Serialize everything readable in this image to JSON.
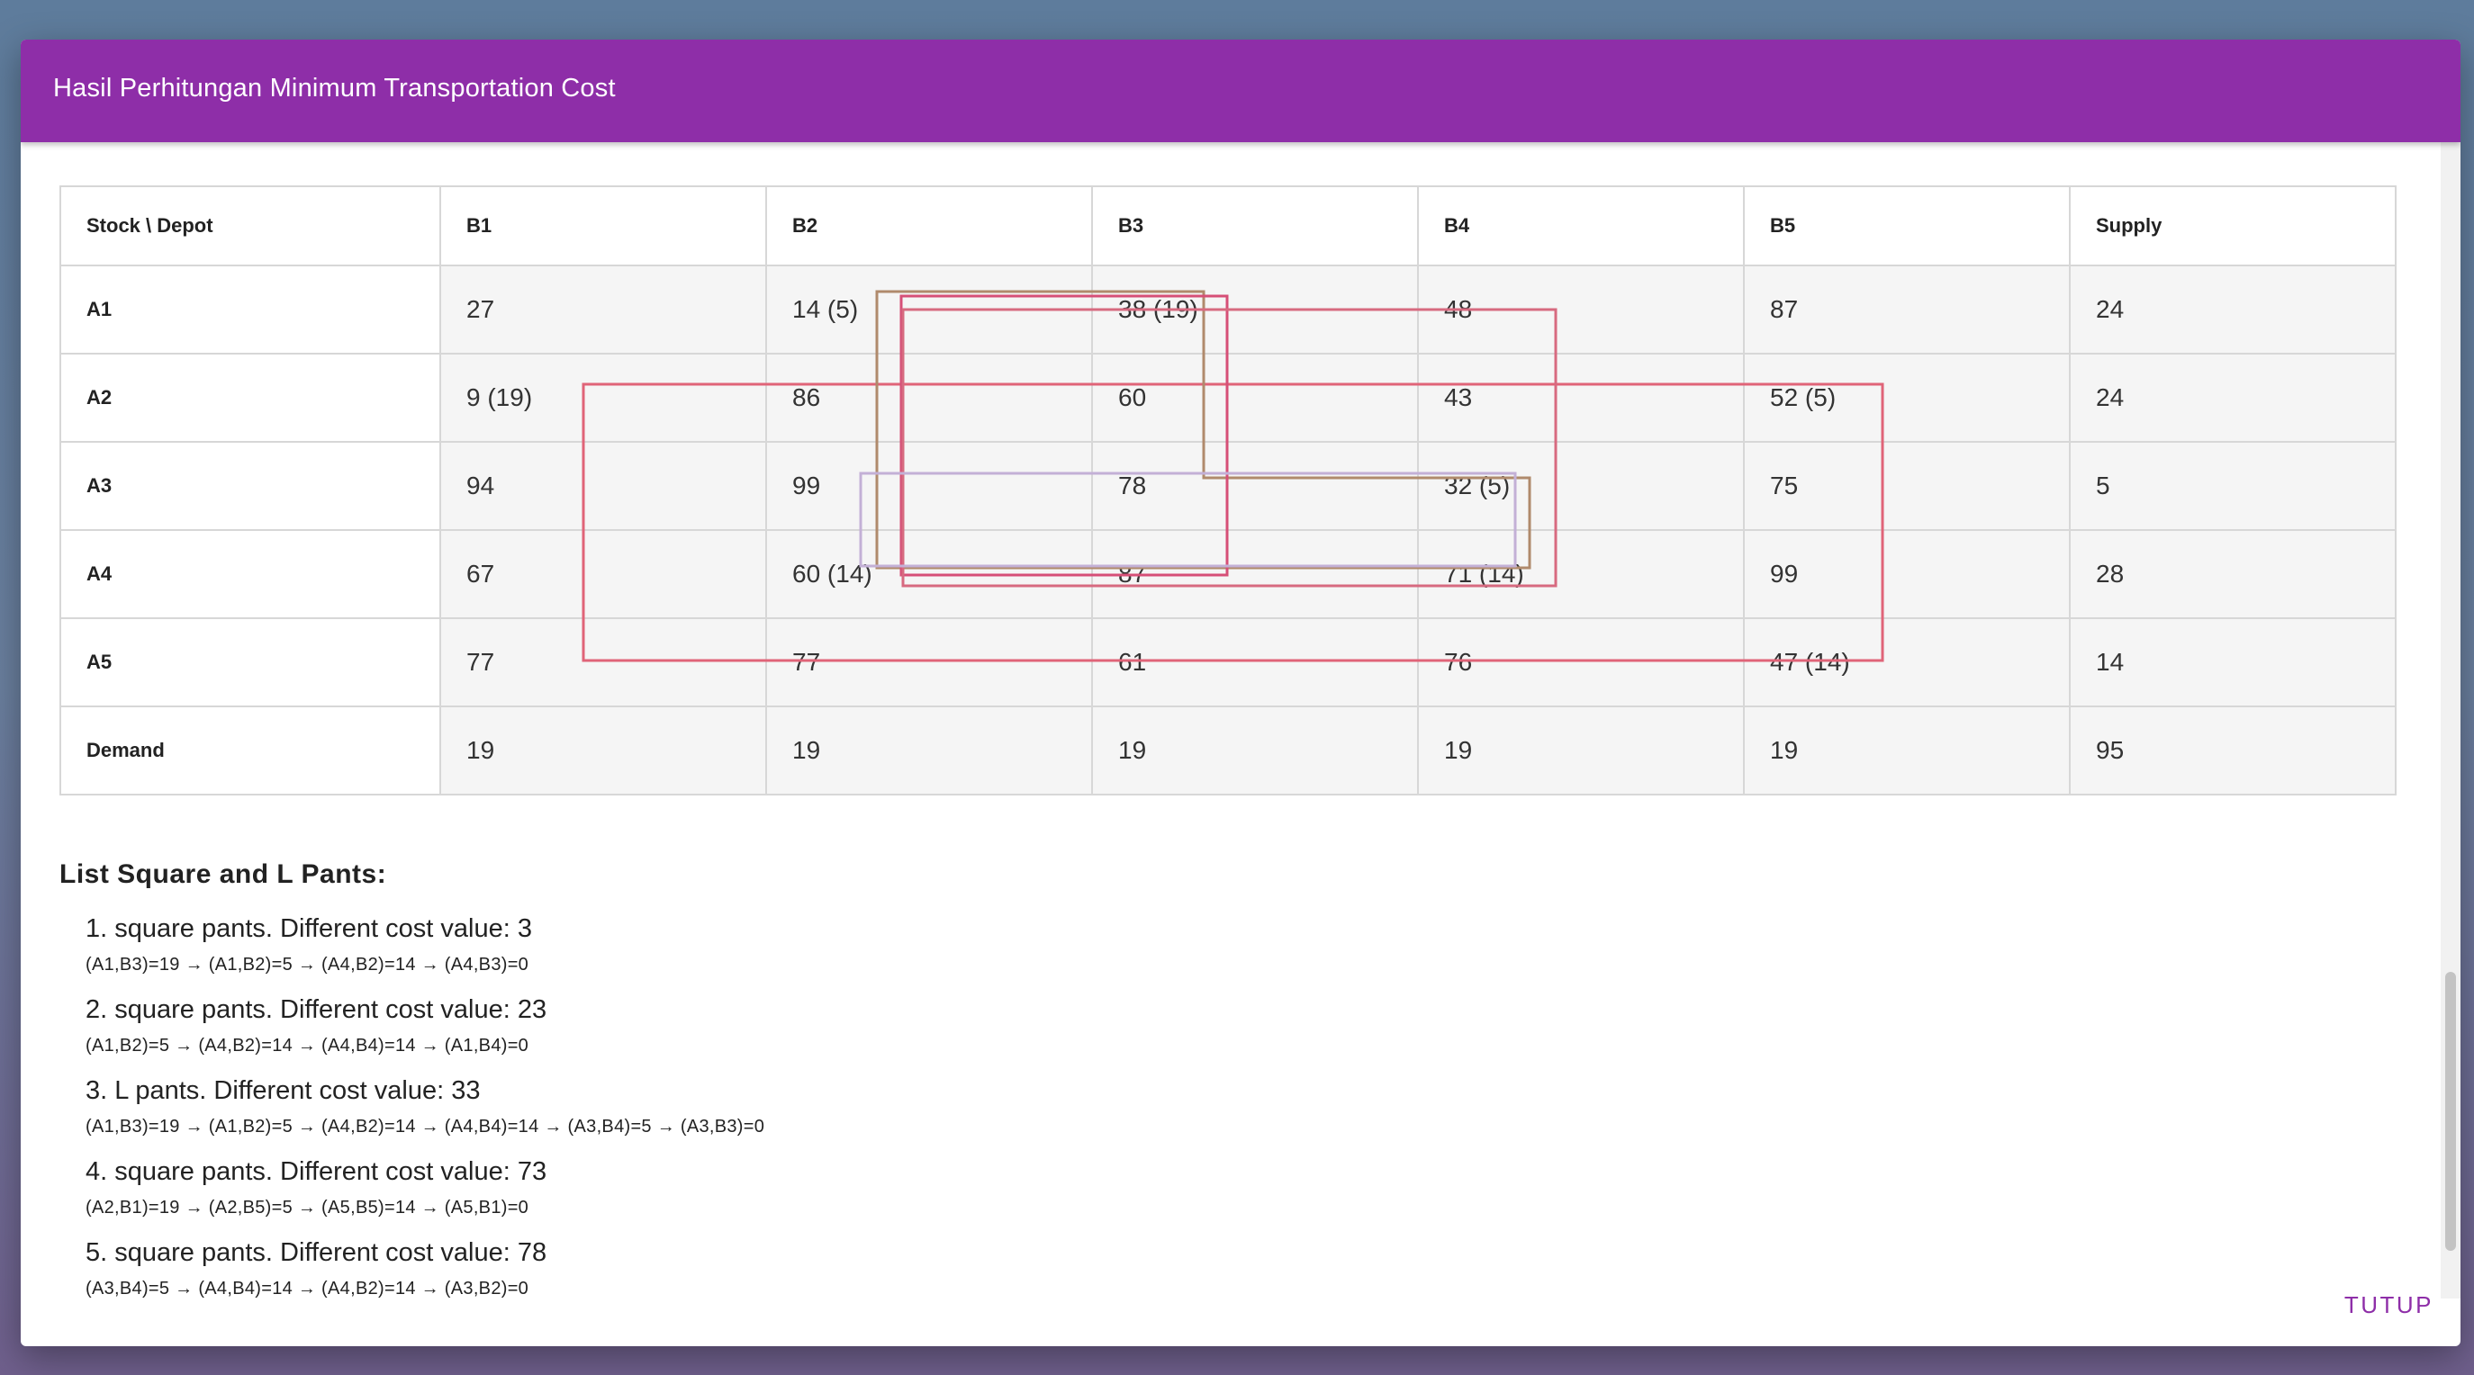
{
  "dialog": {
    "title": "Hasil Perhitungan Minimum Transportation Cost",
    "close_label": "TUTUP",
    "accent_color": "#8e2ea8"
  },
  "table": {
    "headers": [
      "Stock \\ Depot",
      "B1",
      "B2",
      "B3",
      "B4",
      "B5",
      "Supply"
    ],
    "rows": [
      {
        "label": "A1",
        "cells": [
          "27",
          "14 (5)",
          "38 (19)",
          "48",
          "87",
          "24"
        ]
      },
      {
        "label": "A2",
        "cells": [
          "9 (19)",
          "86",
          "60",
          "43",
          "52 (5)",
          "24"
        ]
      },
      {
        "label": "A3",
        "cells": [
          "94",
          "99",
          "78",
          "32 (5)",
          "75",
          "5"
        ]
      },
      {
        "label": "A4",
        "cells": [
          "67",
          "60 (14)",
          "87",
          "71 (14)",
          "99",
          "28"
        ]
      },
      {
        "label": "A5",
        "cells": [
          "77",
          "77",
          "61",
          "76",
          "47 (14)",
          "14"
        ]
      },
      {
        "label": "Demand",
        "cells": [
          "19",
          "19",
          "19",
          "19",
          "19",
          "95"
        ]
      }
    ]
  },
  "loop_colors": {
    "loop1": "#e06478",
    "loop2": "#b08a6c",
    "loop3": "#d64f77",
    "loop4": "#d76a80",
    "loop5": "#c3b0d6"
  },
  "list": {
    "title": "List Square and L Pants:",
    "items": [
      {
        "text": "1. square pants. Different cost value: 3",
        "path": "(A1,B3)=19 → (A1,B2)=5 → (A4,B2)=14 → (A4,B3)=0"
      },
      {
        "text": "2. square pants. Different cost value: 23",
        "path": "(A1,B2)=5 → (A4,B2)=14 → (A4,B4)=14 → (A1,B4)=0"
      },
      {
        "text": "3. L pants. Different cost value: 33",
        "path": "(A1,B3)=19 → (A1,B2)=5 → (A4,B2)=14 → (A4,B4)=14 → (A3,B4)=5 → (A3,B3)=0"
      },
      {
        "text": "4. square pants. Different cost value: 73",
        "path": "(A2,B1)=19 → (A2,B5)=5 → (A5,B5)=14 → (A5,B1)=0"
      },
      {
        "text": "5. square pants. Different cost value: 78",
        "path": "(A3,B4)=5 → (A4,B4)=14 → (A4,B2)=14 → (A3,B2)=0"
      }
    ]
  }
}
